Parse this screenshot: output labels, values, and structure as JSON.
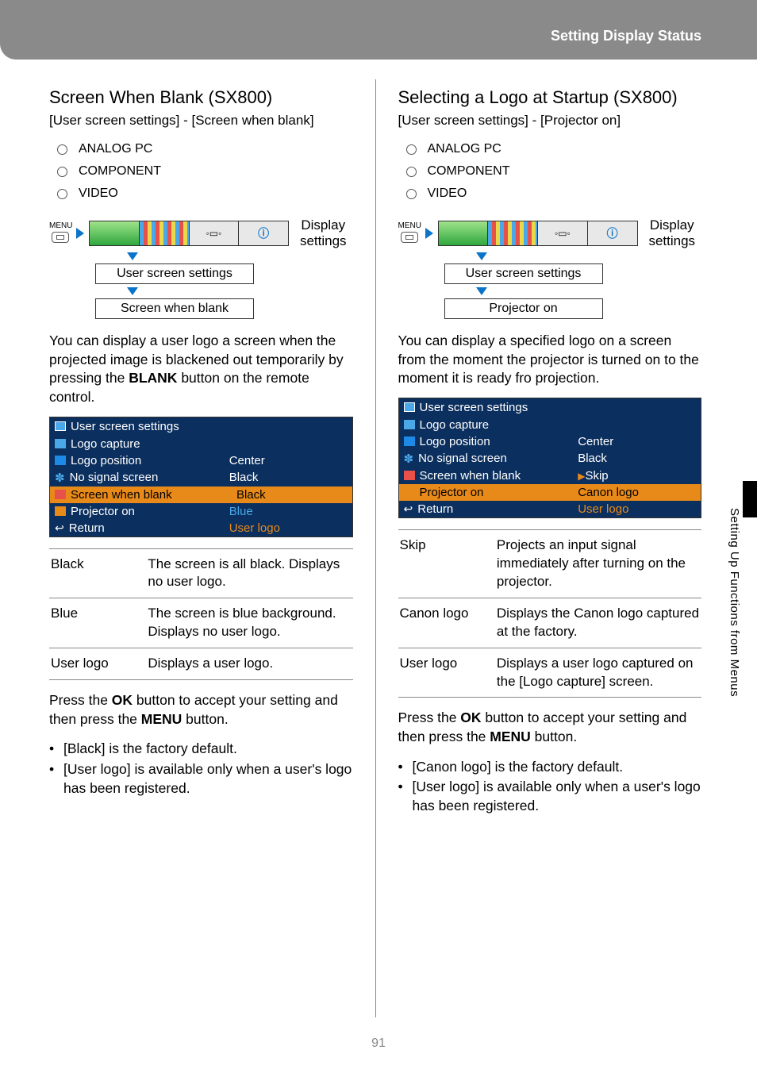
{
  "header": {
    "label": "Setting Display Status"
  },
  "side_tab": "Setting Up Functions from Menus",
  "page_number": "91",
  "left": {
    "title": "Screen When Blank (SX800)",
    "breadcrumb": "[User screen settings] - [Screen when blank]",
    "radios": [
      "ANALOG PC",
      "COMPONENT",
      "VIDEO"
    ],
    "menu": {
      "label_top": "MENU",
      "display_settings": "Display settings",
      "flow1": "User screen settings",
      "flow2": "Screen when blank",
      "tab_cam": "◦▭◦",
      "tab_info": "ⓘ"
    },
    "para1_a": "You can display a user logo a screen when the projected image is blackened out temporarily by pressing the ",
    "para1_b": "BLANK",
    "para1_c": " button on the remote control.",
    "osd": {
      "header": "User screen settings",
      "rows": [
        {
          "label": "Logo capture",
          "value": ""
        },
        {
          "label": "Logo position",
          "value": "Center"
        },
        {
          "label": "No signal screen",
          "value": "Black"
        },
        {
          "label": "Screen when blank",
          "value": "Black",
          "highlight": true,
          "play": true
        },
        {
          "label": "Projector on",
          "value": "Blue",
          "blueval": true
        },
        {
          "label": "Return",
          "value": "User logo",
          "return": true,
          "orangeval": true
        }
      ]
    },
    "options": [
      {
        "k": "Black",
        "v": "The screen is all black. Displays no user logo."
      },
      {
        "k": "Blue",
        "v": "The screen is blue background. Displays no user logo."
      },
      {
        "k": "User logo",
        "v": "Displays a user logo."
      }
    ],
    "footer_a": "Press the ",
    "footer_b": "OK",
    "footer_c": " button to accept your setting and then press the ",
    "footer_d": "MENU",
    "footer_e": " button.",
    "notes": [
      "[Black] is the factory default.",
      "[User logo] is available only when a user's logo has been registered."
    ]
  },
  "right": {
    "title": "Selecting a Logo at Startup (SX800)",
    "breadcrumb": "[User screen settings] - [Projector on]",
    "radios": [
      "ANALOG PC",
      "COMPONENT",
      "VIDEO"
    ],
    "menu": {
      "label_top": "MENU",
      "display_settings": "Display settings",
      "flow1": "User screen settings",
      "flow2": "Projector on",
      "tab_cam": "◦▭◦",
      "tab_info": "ⓘ"
    },
    "para1": "You can display a specified logo on a screen from the moment the projector is turned on to the moment it is ready fro projection.",
    "osd": {
      "header": "User screen settings",
      "rows": [
        {
          "label": "Logo capture",
          "value": ""
        },
        {
          "label": "Logo position",
          "value": "Center"
        },
        {
          "label": "No signal screen",
          "value": "Black"
        },
        {
          "label": "Screen when blank",
          "value": "Skip",
          "play": true
        },
        {
          "label": "Projector on",
          "value": "Canon logo",
          "highlight": true,
          "orangeval": true
        },
        {
          "label": "Return",
          "value": "User logo",
          "return": true,
          "orangeval": true
        }
      ]
    },
    "options": [
      {
        "k": "Skip",
        "v": "Projects an input signal immediately after turning on the projector."
      },
      {
        "k": "Canon logo",
        "v": "Displays the Canon logo captured at the factory."
      },
      {
        "k": "User logo",
        "v": "Displays a user logo captured on the [Logo capture] screen."
      }
    ],
    "footer_a": "Press the ",
    "footer_b": "OK",
    "footer_c": " button to accept your setting and then press the ",
    "footer_d": "MENU",
    "footer_e": " button.",
    "notes": [
      "[Canon logo] is the factory default.",
      "[User logo] is available only when a user's logo has been registered."
    ]
  }
}
